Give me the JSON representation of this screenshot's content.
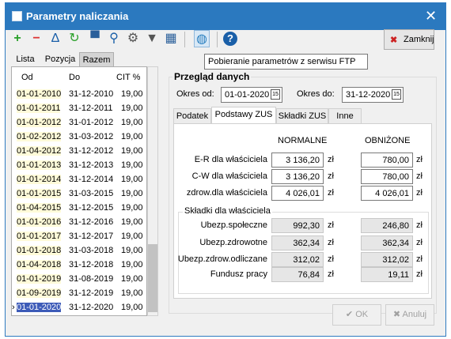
{
  "window": {
    "title": "Parametry naliczania",
    "close": "✕"
  },
  "toolbar": {
    "close_label": "Zamknij"
  },
  "tooltip": "Pobieranie parametrów z serwisu FTP",
  "left_tabs": [
    "Lista",
    "Pozycja",
    "Razem"
  ],
  "grid": {
    "headers": [
      "Od",
      "Do",
      "CIT %"
    ],
    "rows": [
      [
        "01-01-2010",
        "31-12-2010",
        "19,00"
      ],
      [
        "01-01-2011",
        "31-12-2011",
        "19,00"
      ],
      [
        "01-01-2012",
        "31-01-2012",
        "19,00"
      ],
      [
        "01-02-2012",
        "31-03-2012",
        "19,00"
      ],
      [
        "01-04-2012",
        "31-12-2012",
        "19,00"
      ],
      [
        "01-01-2013",
        "31-12-2013",
        "19,00"
      ],
      [
        "01-01-2014",
        "31-12-2014",
        "19,00"
      ],
      [
        "01-01-2015",
        "31-03-2015",
        "19,00"
      ],
      [
        "01-04-2015",
        "31-12-2015",
        "19,00"
      ],
      [
        "01-01-2016",
        "31-12-2016",
        "19,00"
      ],
      [
        "01-01-2017",
        "31-12-2017",
        "19,00"
      ],
      [
        "01-01-2018",
        "31-03-2018",
        "19,00"
      ],
      [
        "01-04-2018",
        "31-12-2018",
        "19,00"
      ],
      [
        "01-01-2019",
        "31-08-2019",
        "19,00"
      ],
      [
        "01-09-2019",
        "31-12-2019",
        "19,00"
      ],
      [
        "01-01-2020",
        "31-12-2020",
        "19,00"
      ]
    ]
  },
  "overview": {
    "title": "Przegląd danych",
    "from_label": "Okres od:",
    "from_value": "01-01-2020",
    "to_label": "Okres do:",
    "to_value": "31-12-2020",
    "cal_glyph": "15"
  },
  "right_tabs": [
    "Podatek",
    "Podstawy ZUS",
    "Składki ZUS",
    "Inne"
  ],
  "zus": {
    "col_normal": "NORMALNE",
    "col_reduced": "OBNIŻONE",
    "unit": "zł",
    "bases": [
      {
        "label": "E-R dla właściciela",
        "normal": "3 136,20",
        "reduced": "780,00"
      },
      {
        "label": "C-W dla właściciela",
        "normal": "3 136,20",
        "reduced": "780,00"
      },
      {
        "label": "zdrow.dla właściciela",
        "normal": "4 026,01",
        "reduced": "4 026,01"
      }
    ],
    "contrib_title": "Składki dla właściciela",
    "contribs": [
      {
        "label": "Ubezp.społeczne",
        "normal": "992,30",
        "reduced": "246,80"
      },
      {
        "label": "Ubezp.zdrowotne",
        "normal": "362,34",
        "reduced": "362,34"
      },
      {
        "label": "Ubezp.zdrow.odliczane",
        "normal": "312,02",
        "reduced": "312,02"
      },
      {
        "label": "Fundusz pracy",
        "normal": "76,84",
        "reduced": "19,11"
      }
    ]
  },
  "buttons": {
    "ok": "OK",
    "cancel": "Anuluj"
  }
}
